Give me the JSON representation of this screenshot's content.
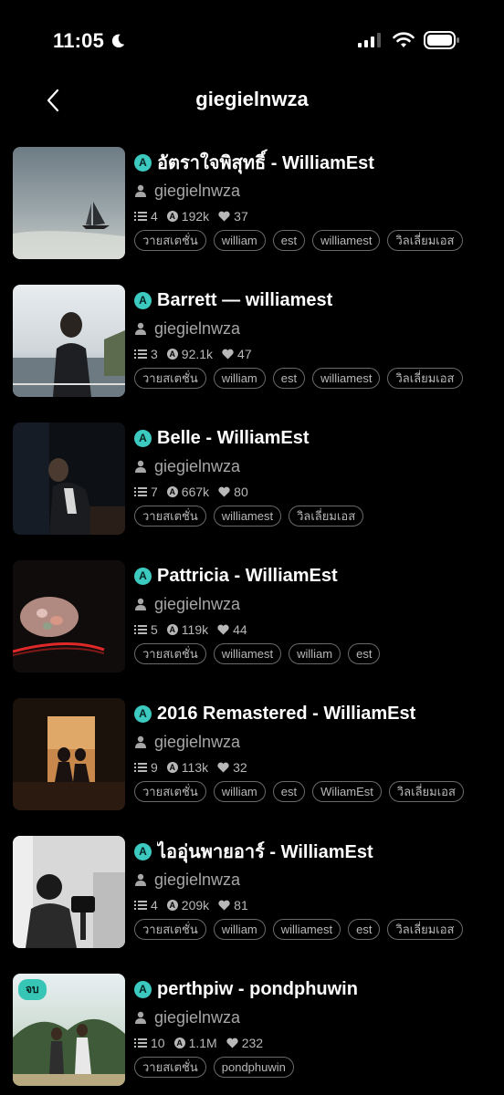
{
  "status_bar": {
    "time": "11:05"
  },
  "nav": {
    "title": "giegielnwza"
  },
  "stories": [
    {
      "title": "อัตราใจพิสุทธิ์ - WilliamEst",
      "author": "giegielnwza",
      "parts": "4",
      "reads": "192k",
      "likes": "37",
      "tags": [
        "วายสเตชั่น",
        "william",
        "est",
        "williamest",
        "วิลเลี่ยมเอส"
      ]
    },
    {
      "title": "Barrett — williamest",
      "author": "giegielnwza",
      "parts": "3",
      "reads": "92.1k",
      "likes": "47",
      "tags": [
        "วายสเตชั่น",
        "william",
        "est",
        "williamest",
        "วิลเลี่ยมเอส"
      ]
    },
    {
      "title": "Belle - WilliamEst",
      "author": "giegielnwza",
      "parts": "7",
      "reads": "667k",
      "likes": "80",
      "tags": [
        "วายสเตชั่น",
        "williamest",
        "วิลเลี่ยมเอส"
      ]
    },
    {
      "title": "Pattricia - WilliamEst",
      "author": "giegielnwza",
      "parts": "5",
      "reads": "119k",
      "likes": "44",
      "tags": [
        "วายสเตชั่น",
        "williamest",
        "william",
        "est"
      ]
    },
    {
      "title": "2016 Remastered - WilliamEst",
      "author": "giegielnwza",
      "parts": "9",
      "reads": "113k",
      "likes": "32",
      "tags": [
        "วายสเตชั่น",
        "william",
        "est",
        "WiliamEst",
        "วิลเลี่ยมเอส"
      ]
    },
    {
      "title": "ไออุ่นพายอาร์ - WilliamEst",
      "author": "giegielnwza",
      "parts": "4",
      "reads": "209k",
      "likes": "81",
      "tags": [
        "วายสเตชั่น",
        "william",
        "williamest",
        "est",
        "วิลเลี่ยมเอส"
      ]
    },
    {
      "title": "perthpiw - pondphuwin",
      "author": "giegielnwza",
      "parts": "10",
      "reads": "1.1M",
      "likes": "232",
      "tags": [
        "วายสเตชั่น",
        "pondphuwin"
      ],
      "badge": "จบ"
    }
  ],
  "badge_letter": "A",
  "colors": {
    "accent": "#3cc9bf",
    "background": "#000000",
    "muted": "#a6a6a6"
  }
}
